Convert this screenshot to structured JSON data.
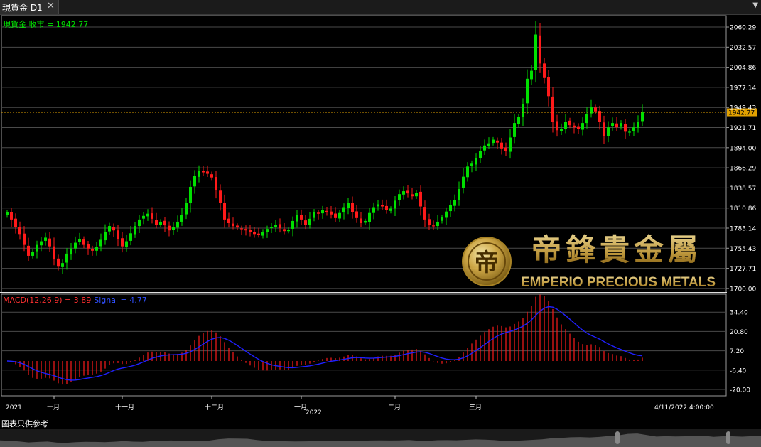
{
  "window": {
    "tab_title": "現貨金 D1",
    "close_glyph": "✕",
    "menu_glyph": "▼"
  },
  "main_label": {
    "name": "現貨金 收市",
    "eq": " = ",
    "value": "1942.77"
  },
  "macd_label": {
    "name": "MACD(12,26,9)",
    "eq": " = ",
    "value": "3.89",
    "signal_name": "Signal",
    "signal_value": "4.77"
  },
  "watermark": {
    "emblem_char": "帝",
    "chinese": "帝鋒貴金屬",
    "english": "EMPERIO PRECIOUS METALS"
  },
  "footnote": "圖表只供參考",
  "chart_data": [
    {
      "type": "candlestick",
      "series_name": "現貨金",
      "last_value": 1942.77,
      "ylim": [
        1695,
        2075
      ],
      "yticks": [
        "2060.29",
        "2032.57",
        "2004.86",
        "1977.14",
        "1949.43",
        "1921.71",
        "1894.00",
        "1866.29",
        "1838.57",
        "1810.86",
        "1783.14",
        "1755.43",
        "1727.71",
        "1700.00"
      ],
      "grid": true,
      "colors": {
        "up": "#00e000",
        "down": "#ff1a1a",
        "last_line": "#e0a000"
      },
      "closes": [
        1805,
        1795,
        1785,
        1775,
        1760,
        1745,
        1750,
        1760,
        1765,
        1770,
        1758,
        1740,
        1730,
        1735,
        1748,
        1755,
        1763,
        1768,
        1760,
        1755,
        1752,
        1757,
        1767,
        1778,
        1786,
        1780,
        1768,
        1758,
        1765,
        1776,
        1786,
        1795,
        1800,
        1803,
        1796,
        1788,
        1792,
        1787,
        1780,
        1785,
        1792,
        1801,
        1818,
        1840,
        1855,
        1862,
        1860,
        1858,
        1853,
        1836,
        1818,
        1795,
        1790,
        1786,
        1784,
        1782,
        1780,
        1778,
        1775,
        1774,
        1778,
        1782,
        1785,
        1788,
        1783,
        1779,
        1781,
        1793,
        1801,
        1795,
        1788,
        1796,
        1805,
        1803,
        1808,
        1806,
        1802,
        1797,
        1804,
        1812,
        1818,
        1805,
        1797,
        1790,
        1793,
        1804,
        1812,
        1816,
        1813,
        1808,
        1810,
        1821,
        1830,
        1834,
        1831,
        1827,
        1832,
        1813,
        1795,
        1788,
        1786,
        1792,
        1798,
        1806,
        1815,
        1822,
        1837,
        1854,
        1868,
        1872,
        1880,
        1889,
        1897,
        1900,
        1905,
        1901,
        1893,
        1889,
        1908,
        1928,
        1936,
        1954,
        1989,
        2000,
        2050,
        2010,
        1990,
        1965,
        1930,
        1918,
        1920,
        1930,
        1925,
        1922,
        1920,
        1928,
        1940,
        1950,
        1944,
        1930,
        1910,
        1922,
        1928,
        1922,
        1928,
        1916,
        1916,
        1922,
        1930,
        1942.77
      ],
      "months": [
        {
          "label": "2021",
          "index": 0
        },
        {
          "label": "十月",
          "index": 11
        },
        {
          "label": "十一月",
          "index": 27
        },
        {
          "label": "十二月",
          "index": 48
        },
        {
          "label": "一月",
          "index": 69
        },
        {
          "label": "二月",
          "index": 91
        },
        {
          "label": "三月",
          "index": 110
        },
        {
          "label": "4/11/2022 4:00:00",
          "index": 160
        }
      ],
      "year_marker": {
        "label": "2022",
        "index": 71
      }
    },
    {
      "type": "macd",
      "params": "12,26,9",
      "macd_last": 3.89,
      "signal_last": 4.77,
      "ylim": [
        -24,
        46
      ],
      "yticks": [
        "34.40",
        "20.80",
        "7.20",
        "-6.40",
        "-20.00"
      ],
      "colors": {
        "macd": "#ff1a1a",
        "signal": "#2020ff"
      }
    }
  ]
}
